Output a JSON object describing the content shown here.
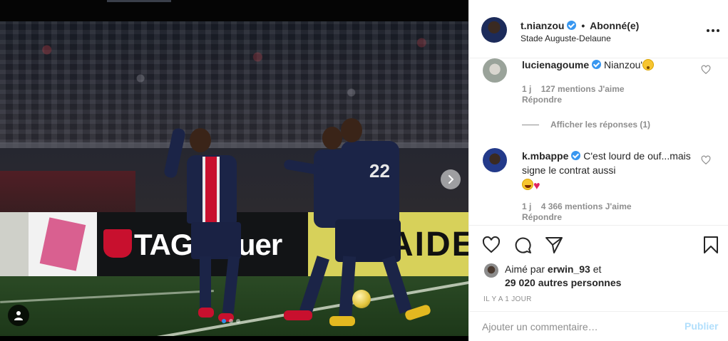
{
  "header": {
    "username": "t.nianzou",
    "separator": "•",
    "follow_status": "Abonné(e)",
    "location": "Stade Auguste-Delaune"
  },
  "photo": {
    "sign_text_1": "TAG Heuer",
    "sign_text_2": "AIDE",
    "jersey_number": "22",
    "carousel_count": 3,
    "carousel_active_index": 0
  },
  "comments": [
    {
      "username": "lucienagoume",
      "text": "Nianzou'",
      "emoji": "flushed-face",
      "time": "1 j",
      "likes": "127 mentions J'aime",
      "reply": "Répondre",
      "show_replies": "Afficher les réponses (1)"
    },
    {
      "username": "k.mbappe",
      "text": "C'est lourd de ouf...mais signe le contrat aussi",
      "emoji": [
        "laughing-face",
        "red-heart"
      ],
      "time": "1 j",
      "likes": "4 366 mentions J'aime",
      "reply": "Répondre"
    }
  ],
  "likes": {
    "prefix": "Aimé par",
    "user": "erwin_93",
    "conjunction": "et",
    "others": "29 020 autres personnes"
  },
  "timestamp": "IL Y A 1 JOUR",
  "add_comment": {
    "placeholder": "Ajouter un commentaire…",
    "publish_label": "Publier"
  },
  "icons": {
    "like": "heart-icon",
    "comment": "comment-icon",
    "share": "share-icon",
    "save": "bookmark-icon",
    "more": "more-options-icon",
    "verified": "verified-badge-icon",
    "next": "chevron-right-icon",
    "tags": "user-tag-icon"
  },
  "colors": {
    "verified_blue": "#3897f0",
    "muted_text": "#8e8e8e",
    "publish_disabled": "#b2dffc",
    "carousel_active": "#2f8fe6"
  }
}
